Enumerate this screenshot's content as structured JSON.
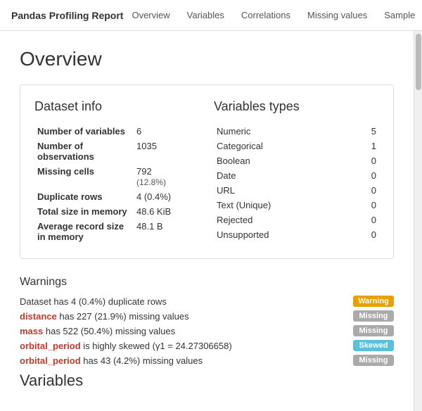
{
  "header": {
    "title": "Pandas Profiling Report",
    "nav": [
      {
        "label": "Overview",
        "id": "nav-overview"
      },
      {
        "label": "Variables",
        "id": "nav-variables"
      },
      {
        "label": "Correlations",
        "id": "nav-correlations"
      },
      {
        "label": "Missing values",
        "id": "nav-missing-values"
      },
      {
        "label": "Sample",
        "id": "nav-sample"
      }
    ]
  },
  "page": {
    "title": "Overview"
  },
  "dataset_info": {
    "section_title": "Dataset info",
    "rows": [
      {
        "label": "Number of variables",
        "value": "6"
      },
      {
        "label": "Number of observations",
        "value": "1035"
      },
      {
        "label": "Missing cells",
        "value": "792",
        "subtext": "(12.8%)"
      },
      {
        "label": "Duplicate rows",
        "value": "4 (0.4%)"
      },
      {
        "label": "Total size in memory",
        "value": "48.6 KiB"
      },
      {
        "label": "Average record size in memory",
        "value": "48.1 B"
      }
    ]
  },
  "variables_types": {
    "section_title": "Variables types",
    "rows": [
      {
        "label": "Numeric",
        "value": "5"
      },
      {
        "label": "Categorical",
        "value": "1"
      },
      {
        "label": "Boolean",
        "value": "0"
      },
      {
        "label": "Date",
        "value": "0"
      },
      {
        "label": "URL",
        "value": "0"
      },
      {
        "label": "Text (Unique)",
        "value": "0"
      },
      {
        "label": "Rejected",
        "value": "0"
      },
      {
        "label": "Unsupported",
        "value": "0"
      }
    ]
  },
  "warnings": {
    "title": "Warnings",
    "items": [
      {
        "text_before": "Dataset has 4 (0.4%) duplicate rows",
        "var": "",
        "text_after": "",
        "badge": "Warning",
        "badge_class": "badge-warning"
      },
      {
        "text_before": "",
        "var": "distance",
        "text_after": " has 227 (21.9%) missing values",
        "badge": "Missing",
        "badge_class": "badge-missing"
      },
      {
        "text_before": "",
        "var": "mass",
        "text_after": " has 522 (50.4%) missing values",
        "badge": "Missing",
        "badge_class": "badge-missing"
      },
      {
        "text_before": "",
        "var": "orbital_period",
        "text_after": " is highly skewed (γ1 = 24.27306658)",
        "badge": "Skewed",
        "badge_class": "badge-skewed"
      },
      {
        "text_before": "",
        "var": "orbital_period",
        "text_after": " has 43 (4.2%) missing values",
        "badge": "Missing",
        "badge_class": "badge-missing"
      }
    ]
  },
  "variables_section": {
    "title": "Variables"
  }
}
